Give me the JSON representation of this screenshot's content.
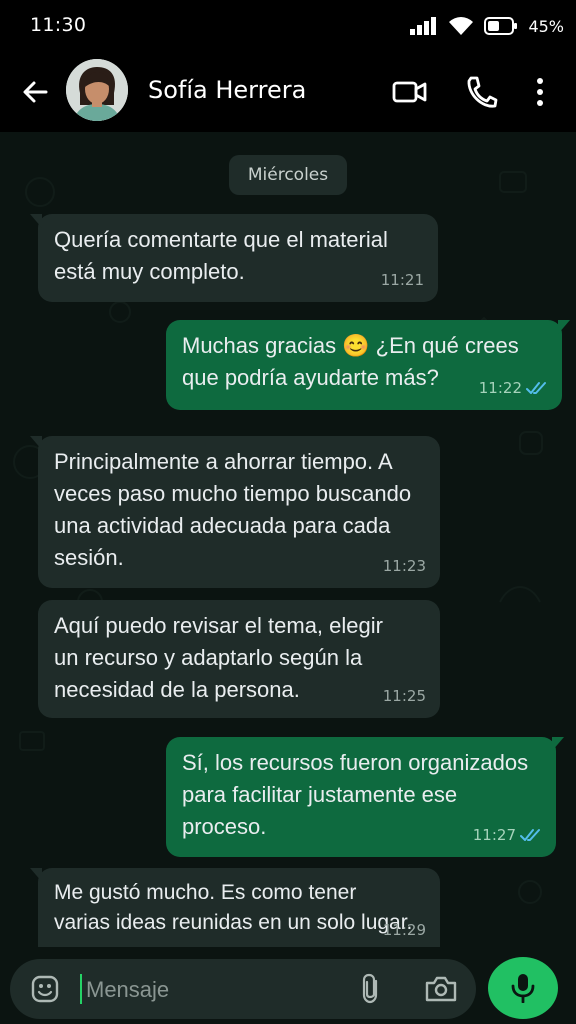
{
  "status_bar": {
    "time": "11:30",
    "battery": "45%",
    "icons": [
      "signal-icon",
      "wifi-icon",
      "battery-icon"
    ]
  },
  "header": {
    "contact_name": "Sofía Herrera",
    "icons": [
      "back-arrow-icon",
      "video-call-icon",
      "phone-icon",
      "more-vert-icon"
    ]
  },
  "chat": {
    "date_label": "Miércoles",
    "messages": [
      {
        "direction": "in",
        "text_lines": [
          "Quería comentarte que el material",
          "está muy completo."
        ],
        "time": "11:21"
      },
      {
        "direction": "out",
        "text_lines": [
          "Muchas gracias 😊 ¿En qué crees",
          "que podría ayudarte más?"
        ],
        "time": "11:22",
        "status": "read"
      },
      {
        "direction": "in",
        "text_lines": [
          "Principalmente a ahorrar tiempo. A",
          "veces paso mucho tiempo buscando",
          "una actividad adecuada para cada",
          "sesión."
        ],
        "time": "11:23"
      },
      {
        "direction": "in",
        "text_lines": [
          "Aquí puedo revisar el tema, elegir",
          "un recurso y adaptarlo según la",
          "necesidad de la persona."
        ],
        "time": "11:25"
      },
      {
        "direction": "out",
        "text_lines": [
          "Sí, los recursos fueron organizados",
          "para facilitar justamente ese",
          "proceso."
        ],
        "time": "11:27",
        "status": "read"
      },
      {
        "direction": "in",
        "text_lines": [
          "Me gustó mucho. Es como tener",
          "varias ideas reunidas en un solo lugar."
        ],
        "time": "11:29"
      }
    ]
  },
  "composer": {
    "placeholder": "Mensaje",
    "icons": [
      "emoji-icon",
      "attach-icon",
      "camera-icon",
      "mic-icon"
    ]
  },
  "colors": {
    "incoming_bubble": "#1f2c29",
    "outgoing_bubble": "#0e6a3f",
    "accent": "#21c063",
    "read_ticks": "#53bdeb",
    "header_bg": "#000000"
  }
}
